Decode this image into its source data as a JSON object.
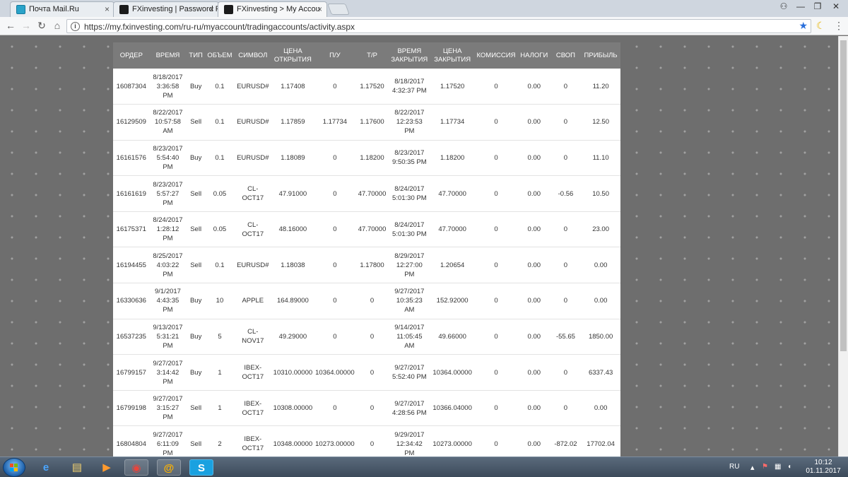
{
  "browser": {
    "tabs": [
      {
        "title": "Почта Mail.Ru",
        "close": "×"
      },
      {
        "title": "FXinvesting | Password R",
        "close": "×"
      },
      {
        "title": "FXinvesting > My Accou",
        "close": "×"
      }
    ],
    "window_controls": {
      "user": "⚇",
      "minimize": "—",
      "maximize": "❐",
      "close": "✕"
    },
    "nav": {
      "back": "←",
      "forward": "→",
      "reload": "↻",
      "home": "⌂"
    },
    "url": "https://my.fxinvesting.com/ru-ru/myaccount/tradingaccounts/activity.aspx",
    "info_icon": "i",
    "star": "★",
    "moon": "☾",
    "menu": "⋮"
  },
  "table": {
    "headers": [
      "ОРДЕР",
      "ВРЕМЯ",
      "ТИП",
      "ОБЪЕМ",
      "СИМВОЛ",
      "ЦЕНА\nОТКРЫТИЯ",
      "П/У",
      "Т/Р",
      "ВРЕМЯ\nЗАКРЫТИЯ",
      "ЦЕНА\nЗАКРЫТИЯ",
      "КОМИССИЯ",
      "НАЛОГИ",
      "СВОП",
      "ПРИБЫЛЬ"
    ],
    "rows": [
      [
        "16087304",
        "8/18/2017\n3:36:58\nPM",
        "Buy",
        "0.1",
        "EURUSD#",
        "1.17408",
        "0",
        "1.17520",
        "8/18/2017\n4:32:37 PM",
        "1.17520",
        "0",
        "0.00",
        "0",
        "11.20"
      ],
      [
        "16129509",
        "8/22/2017\n10:57:58\nAM",
        "Sell",
        "0.1",
        "EURUSD#",
        "1.17859",
        "1.17734",
        "1.17600",
        "8/22/2017\n12:23:53\nPM",
        "1.17734",
        "0",
        "0.00",
        "0",
        "12.50"
      ],
      [
        "16161576",
        "8/23/2017\n5:54:40\nPM",
        "Buy",
        "0.1",
        "EURUSD#",
        "1.18089",
        "0",
        "1.18200",
        "8/23/2017\n9:50:35 PM",
        "1.18200",
        "0",
        "0.00",
        "0",
        "11.10"
      ],
      [
        "16161619",
        "8/23/2017\n5:57:27\nPM",
        "Sell",
        "0.05",
        "CL-\nOCT17",
        "47.91000",
        "0",
        "47.70000",
        "8/24/2017\n5:01:30 PM",
        "47.70000",
        "0",
        "0.00",
        "-0.56",
        "10.50"
      ],
      [
        "16175371",
        "8/24/2017\n1:28:12\nPM",
        "Sell",
        "0.05",
        "CL-\nOCT17",
        "48.16000",
        "0",
        "47.70000",
        "8/24/2017\n5:01:30 PM",
        "47.70000",
        "0",
        "0.00",
        "0",
        "23.00"
      ],
      [
        "16194455",
        "8/25/2017\n4:03:22\nPM",
        "Sell",
        "0.1",
        "EURUSD#",
        "1.18038",
        "0",
        "1.17800",
        "8/29/2017\n12:27:00\nPM",
        "1.20654",
        "0",
        "0.00",
        "0",
        "0.00"
      ],
      [
        "16330636",
        "9/1/2017\n4:43:35\nPM",
        "Buy",
        "10",
        "APPLE",
        "164.89000",
        "0",
        "0",
        "9/27/2017\n10:35:23\nAM",
        "152.92000",
        "0",
        "0.00",
        "0",
        "0.00"
      ],
      [
        "16537235",
        "9/13/2017\n5:31:21\nPM",
        "Buy",
        "5",
        "CL-\nNOV17",
        "49.29000",
        "0",
        "0",
        "9/14/2017\n11:05:45\nAM",
        "49.66000",
        "0",
        "0.00",
        "-55.65",
        "1850.00"
      ],
      [
        "16799157",
        "9/27/2017\n3:14:42\nPM",
        "Buy",
        "1",
        "IBEX-\nOCT17",
        "10310.00000",
        "10364.00000",
        "0",
        "9/27/2017\n5:52:40 PM",
        "10364.00000",
        "0",
        "0.00",
        "0",
        "6337.43"
      ],
      [
        "16799198",
        "9/27/2017\n3:15:27\nPM",
        "Sell",
        "1",
        "IBEX-\nOCT17",
        "10308.00000",
        "0",
        "0",
        "9/27/2017\n4:28:56 PM",
        "10366.04000",
        "0",
        "0.00",
        "0",
        "0.00"
      ],
      [
        "16804804",
        "9/27/2017\n6:11:09\nPM",
        "Sell",
        "2",
        "IBEX-\nOCT17",
        "10348.00000",
        "10273.00000",
        "0",
        "9/29/2017\n12:34:42\nPM",
        "10273.00000",
        "0",
        "0.00",
        "-872.02",
        "17702.04"
      ]
    ]
  },
  "taskbar": {
    "apps": [
      {
        "name": "ie-icon",
        "glyph": "e"
      },
      {
        "name": "explorer-icon",
        "glyph": "▤"
      },
      {
        "name": "media-player-icon",
        "glyph": "▶"
      },
      {
        "name": "chrome-icon",
        "glyph": "◉"
      },
      {
        "name": "mail-agent-icon",
        "glyph": "@"
      },
      {
        "name": "skype-icon",
        "glyph": "S"
      }
    ],
    "language": "RU",
    "tray_icons": [
      "⚑",
      "▦",
      "◖"
    ],
    "time": "10:12",
    "date": "01.11.2017"
  }
}
